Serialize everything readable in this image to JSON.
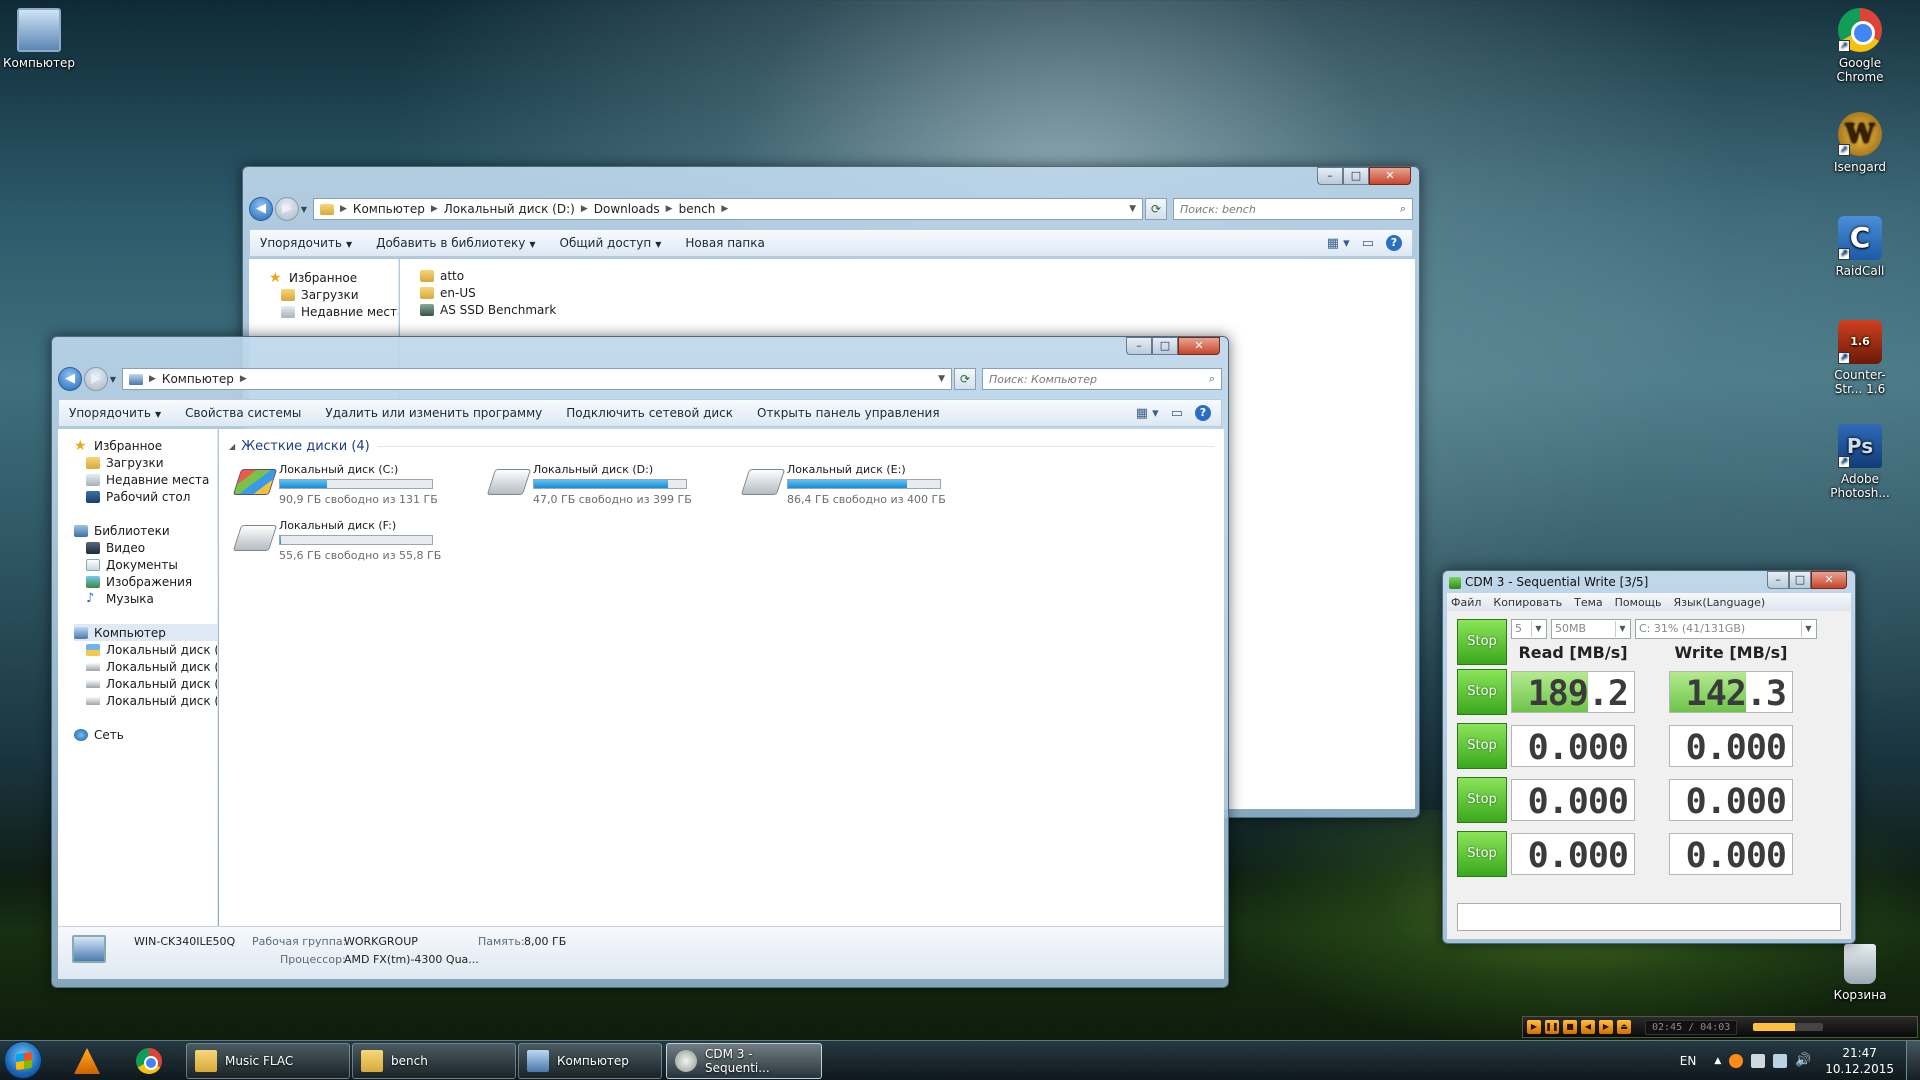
{
  "desktop": {
    "icons_left": [
      {
        "label": "Компьютер",
        "icon": "computer-icon"
      }
    ],
    "icons_right": [
      {
        "label": "Google Chrome",
        "icon": "chrome-icon"
      },
      {
        "label": "Isengard",
        "icon": "warcraft-icon"
      },
      {
        "label": "RaidCall",
        "icon": "raidcall-icon"
      },
      {
        "label": "Counter-Str... 1.6",
        "icon": "counter-strike-icon"
      },
      {
        "label": "Adobe Photosh...",
        "icon": "photoshop-icon"
      }
    ],
    "recycle_bin": "Корзина"
  },
  "explorer_bench": {
    "path": [
      "Компьютер",
      "Локальный диск (D:)",
      "Downloads",
      "bench"
    ],
    "search_placeholder": "Поиск: bench",
    "commands": [
      "Упорядочить",
      "Добавить в библиотеку",
      "Общий доступ",
      "Новая папка"
    ],
    "nav": [
      "Избранное",
      "Загрузки",
      "Недавние места"
    ],
    "files": [
      "atto",
      "en-US",
      "AS SSD Benchmark"
    ]
  },
  "explorer_computer": {
    "path": [
      "Компьютер"
    ],
    "search_placeholder": "Поиск: Компьютер",
    "commands": [
      "Упорядочить",
      "Свойства системы",
      "Удалить или изменить программу",
      "Подключить сетевой диск",
      "Открыть панель управления"
    ],
    "nav": {
      "favorites": [
        "Избранное",
        "Загрузки",
        "Недавние места",
        "Рабочий стол"
      ],
      "libraries": [
        "Библиотеки",
        "Видео",
        "Документы",
        "Изображения",
        "Музыка"
      ],
      "computer": [
        "Компьютер",
        "Локальный диск (C",
        "Локальный диск (D",
        "Локальный диск (E:",
        "Локальный диск (F:"
      ],
      "network": "Сеть"
    },
    "group_title": "Жесткие диски (4)",
    "drives": [
      {
        "name": "Локальный диск (C:)",
        "free": "90,9 ГБ свободно из 131 ГБ",
        "used_fraction": 0.31
      },
      {
        "name": "Локальный диск (D:)",
        "free": "47,0 ГБ свободно из 399 ГБ",
        "used_fraction": 0.88
      },
      {
        "name": "Локальный диск (E:)",
        "free": "86,4 ГБ свободно из 400 ГБ",
        "used_fraction": 0.78
      },
      {
        "name": "Локальный диск (F:)",
        "free": "55,6 ГБ свободно из 55,8 ГБ",
        "used_fraction": 0.004
      }
    ],
    "details": {
      "computer_name": "WIN-CK340ILE50Q",
      "workgroup_label": "Рабочая группа:",
      "workgroup": "WORKGROUP",
      "memory_label": "Память:",
      "memory": "8,00 ГБ",
      "cpu_label": "Процессор:",
      "cpu": "AMD FX(tm)-4300 Qua..."
    }
  },
  "cdm": {
    "title": "CDM 3 - Sequential Write [3/5]",
    "menu": [
      "Файл",
      "Копировать",
      "Тема",
      "Помощь",
      "Язык(Language)"
    ],
    "runs": "5",
    "size": "50MB",
    "drive": "C: 31% (41/131GB)",
    "stop_label": "Stop",
    "read_header": "Read [MB/s]",
    "write_header": "Write [MB/s]",
    "rows": [
      {
        "read": "189.2",
        "write": "142.3",
        "read_fill": 0.62,
        "write_fill": 0.62
      },
      {
        "read": "0.000",
        "write": "0.000",
        "read_fill": 0,
        "write_fill": 0
      },
      {
        "read": "0.000",
        "write": "0.000",
        "read_fill": 0,
        "write_fill": 0
      },
      {
        "read": "0.000",
        "write": "0.000",
        "read_fill": 0,
        "write_fill": 0
      }
    ]
  },
  "taskbar": {
    "tasks": [
      "Music FLAC",
      "bench",
      "Компьютер",
      "CDM 3 - Sequenti..."
    ],
    "lang": "EN",
    "time": "21:47",
    "date": "10.12.2015",
    "player_time": "02:45 / 04:03"
  }
}
